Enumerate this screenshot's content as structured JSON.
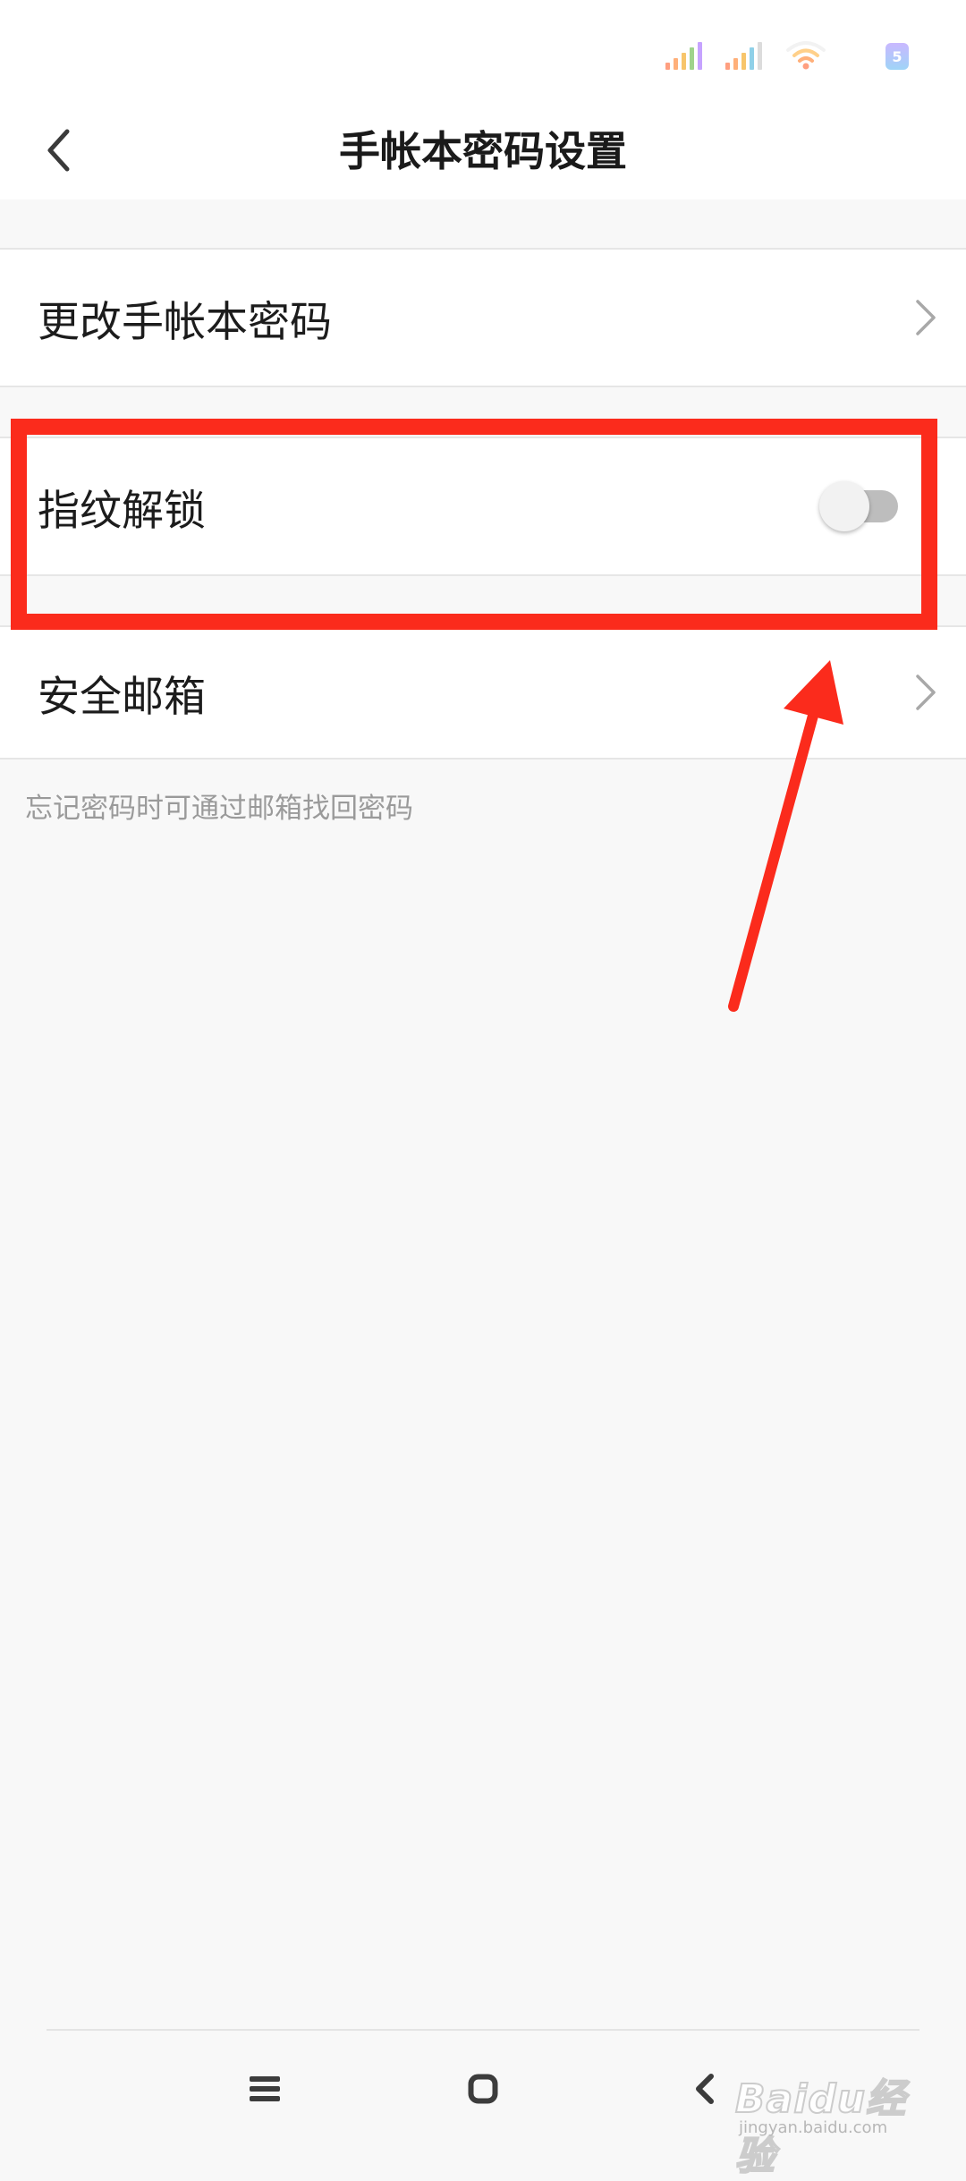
{
  "status_bar": {
    "battery_text": "5",
    "icons": [
      "signal-1-icon",
      "signal-2-icon",
      "wifi-icon",
      "battery-icon"
    ]
  },
  "header": {
    "title": "手帐本密码设置",
    "back_icon": "chevron-left-icon"
  },
  "settings": {
    "change_password": {
      "label": "更改手帐本密码",
      "icon": "chevron-right-icon"
    },
    "fingerprint_unlock": {
      "label": "指纹解锁",
      "toggle_on": false
    },
    "security_email": {
      "label": "安全邮箱",
      "icon": "chevron-right-icon"
    },
    "hint": "忘记密码时可通过邮箱找回密码"
  },
  "annotation": {
    "color": "#fb2b1c"
  },
  "nav_bar": {
    "icons": [
      "menu-icon",
      "home-icon",
      "back-icon"
    ]
  },
  "watermark": {
    "logo_text": "Baidu经验",
    "url": "jingyan.baidu.com"
  }
}
